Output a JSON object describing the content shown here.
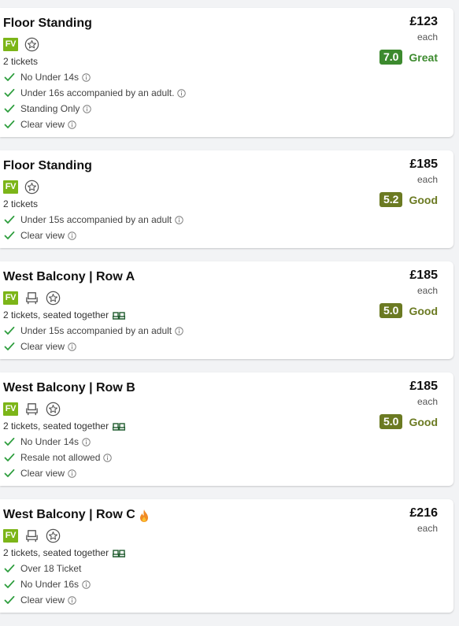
{
  "colors": {
    "great": "#3c8a2e",
    "good": "#6b7a22",
    "check": "#2e9e3e",
    "fv": "#7cb518"
  },
  "listings": [
    {
      "title": "Floor Standing",
      "flame": false,
      "seat_icon": false,
      "badge": "FV",
      "subtitle": "2 tickets",
      "seated_together": false,
      "features": [
        {
          "text": "No Under 14s",
          "info": true
        },
        {
          "text": "Under 16s accompanied by an adult.",
          "info": true
        },
        {
          "text": "Standing Only",
          "info": true
        },
        {
          "text": "Clear view",
          "info": true
        }
      ],
      "price": "£123",
      "each": "each",
      "score": "7.0",
      "rating_label": "Great",
      "rating_color": "#3c8a2e"
    },
    {
      "title": "Floor Standing",
      "flame": false,
      "seat_icon": false,
      "badge": "FV",
      "subtitle": "2 tickets",
      "seated_together": false,
      "features": [
        {
          "text": "Under 15s accompanied by an adult",
          "info": true
        },
        {
          "text": "Clear view",
          "info": true
        }
      ],
      "price": "£185",
      "each": "each",
      "score": "5.2",
      "rating_label": "Good",
      "rating_color": "#6b7a22"
    },
    {
      "title": "West Balcony | Row A",
      "flame": false,
      "seat_icon": true,
      "badge": "FV",
      "subtitle": "2 tickets, seated together",
      "seated_together": true,
      "features": [
        {
          "text": "Under 15s accompanied by an adult",
          "info": true
        },
        {
          "text": "Clear view",
          "info": true
        }
      ],
      "price": "£185",
      "each": "each",
      "score": "5.0",
      "rating_label": "Good",
      "rating_color": "#6b7a22"
    },
    {
      "title": "West Balcony | Row B",
      "flame": false,
      "seat_icon": true,
      "badge": "FV",
      "subtitle": "2 tickets, seated together",
      "seated_together": true,
      "features": [
        {
          "text": "No Under 14s",
          "info": true
        },
        {
          "text": "Resale not allowed",
          "info": true
        },
        {
          "text": "Clear view",
          "info": true
        }
      ],
      "price": "£185",
      "each": "each",
      "score": "5.0",
      "rating_label": "Good",
      "rating_color": "#6b7a22"
    },
    {
      "title": "West Balcony | Row C",
      "flame": true,
      "seat_icon": true,
      "badge": "FV",
      "subtitle": "2 tickets, seated together",
      "seated_together": true,
      "features": [
        {
          "text": "Over 18 Ticket",
          "info": false
        },
        {
          "text": "No Under 16s",
          "info": true
        },
        {
          "text": "Clear view",
          "info": true
        }
      ],
      "price": "£216",
      "each": "each",
      "score": null,
      "rating_label": null,
      "rating_color": null
    }
  ]
}
